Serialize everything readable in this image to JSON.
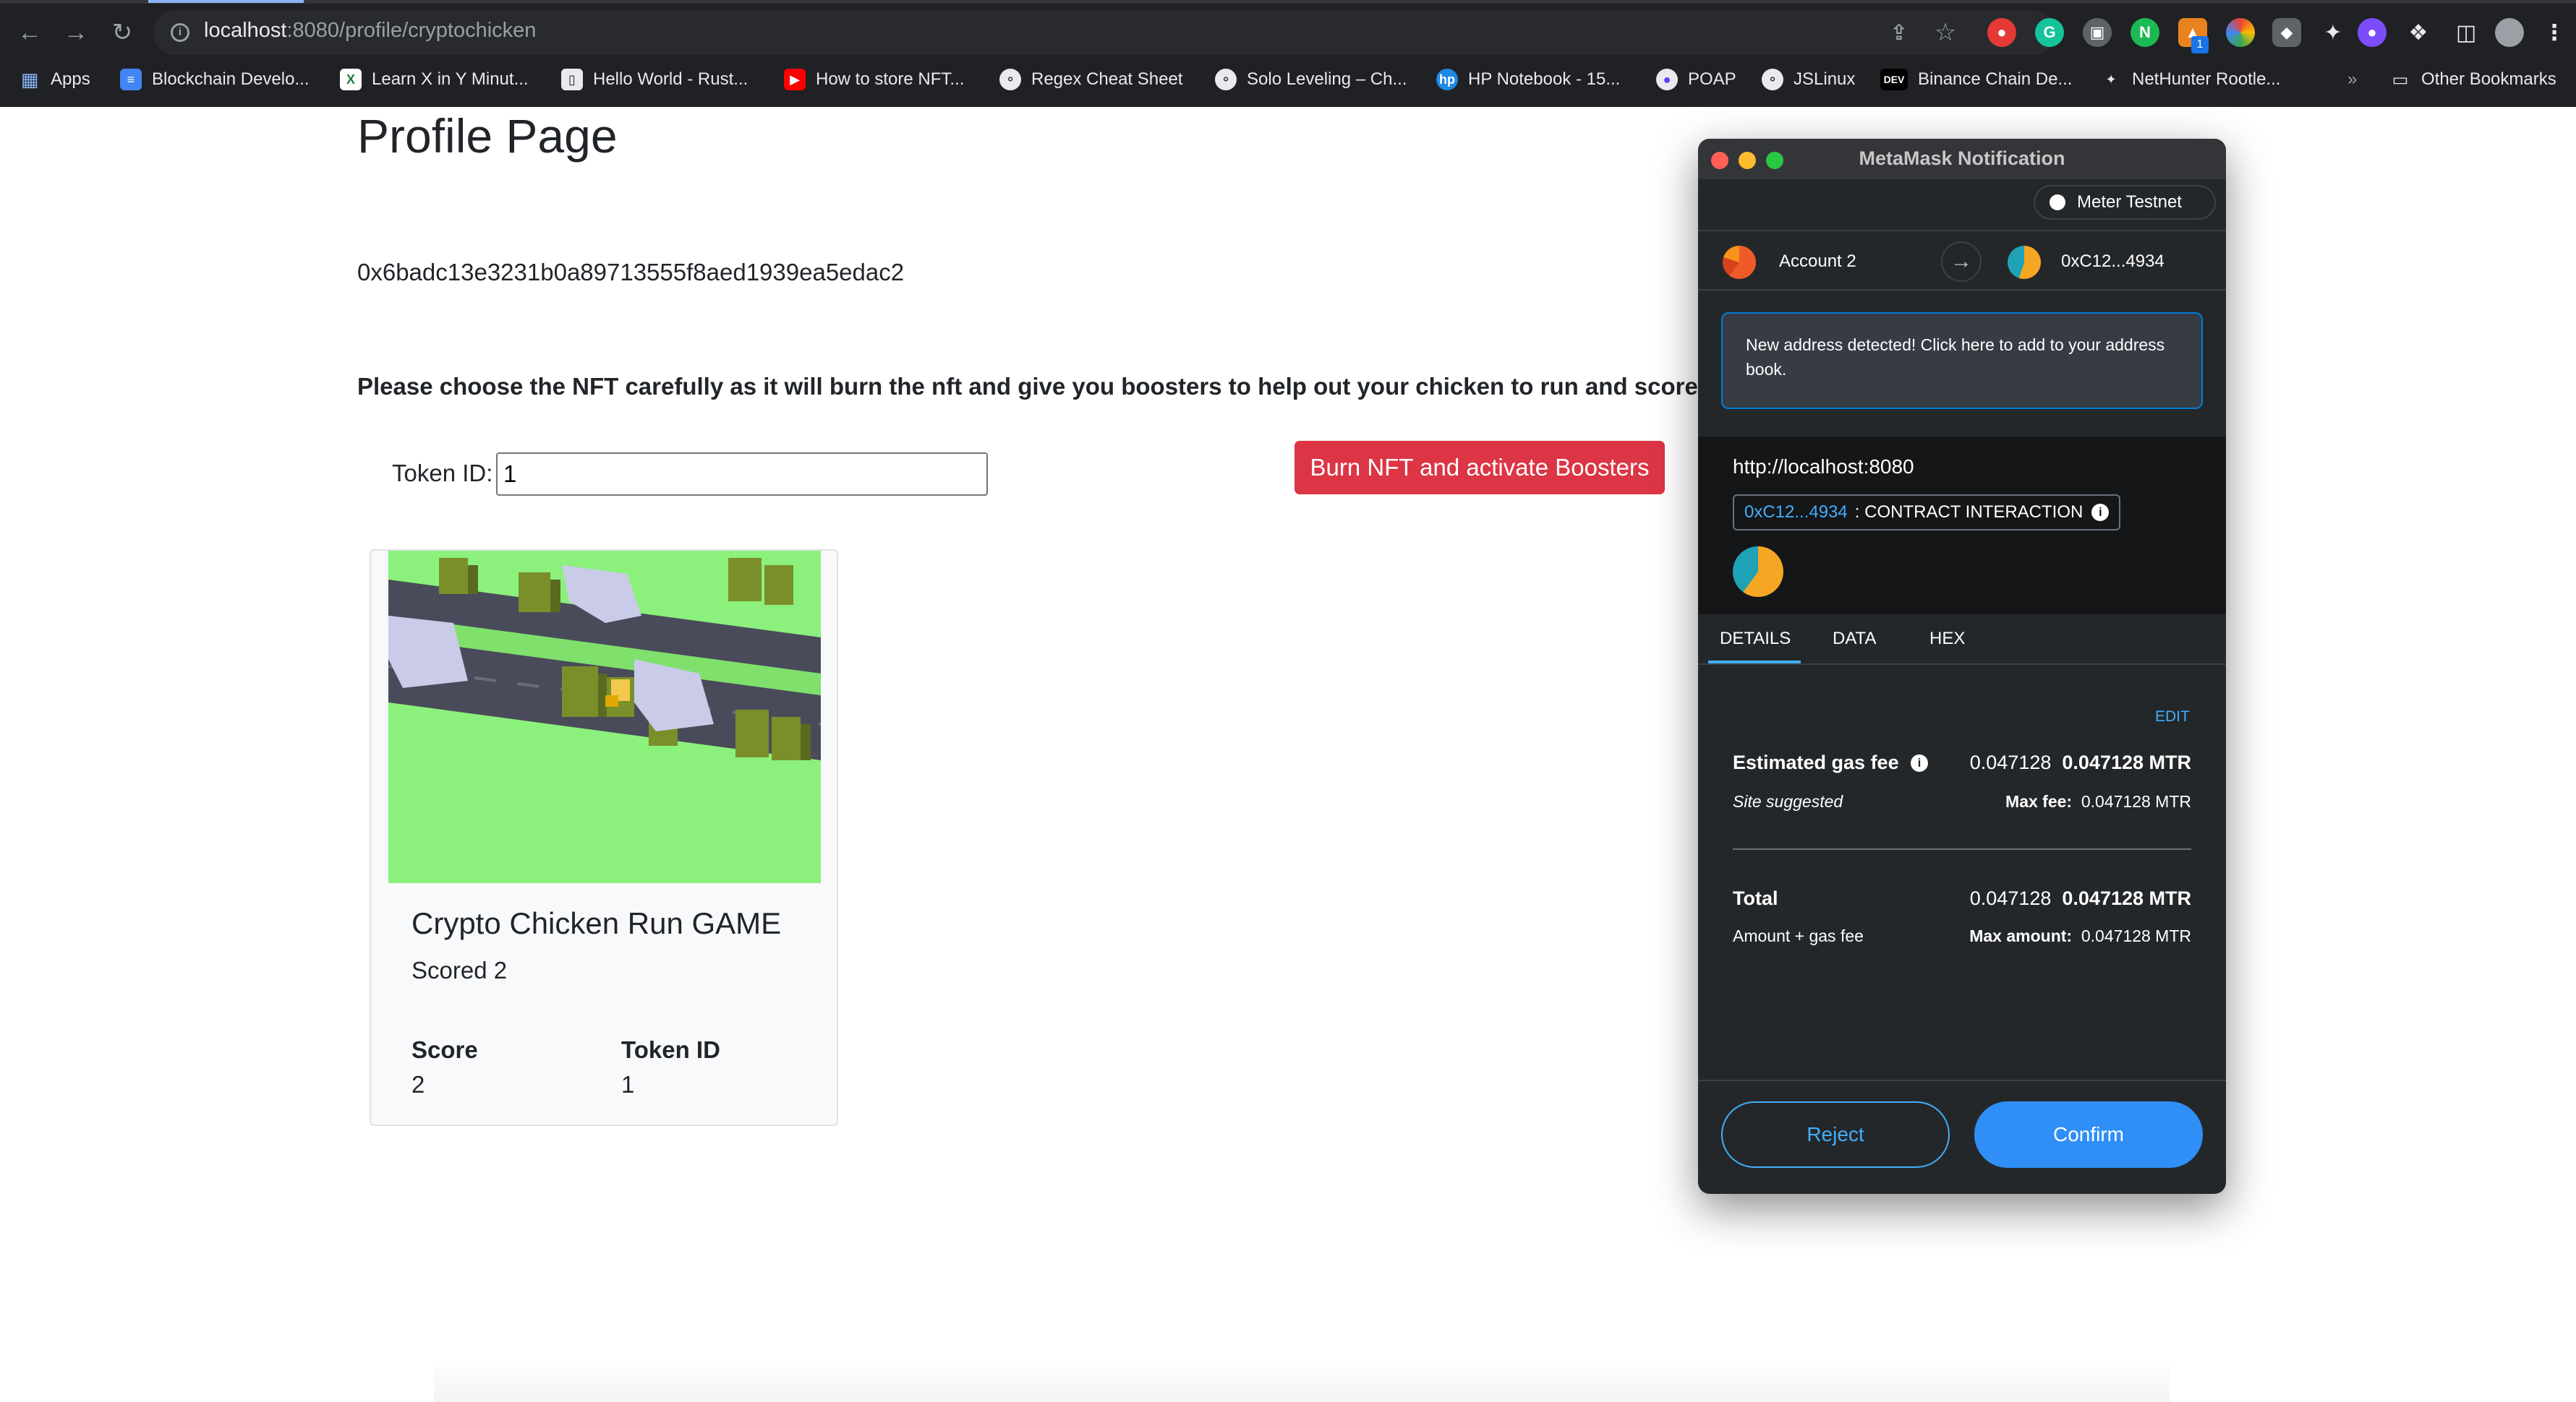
{
  "browser": {
    "url_host": "localhost",
    "url_path": ":8080/profile/cryptochicken",
    "bookmarks": [
      {
        "label": "Apps",
        "icon": "apps-grid-icon"
      },
      {
        "label": "Blockchain Develo...",
        "icon": "docs-icon"
      },
      {
        "label": "Learn X in Y Minut...",
        "icon": "x-logo-icon"
      },
      {
        "label": "Hello World - Rust...",
        "icon": "book-icon"
      },
      {
        "label": "How to store NFT...",
        "icon": "youtube-icon"
      },
      {
        "label": "Regex Cheat Sheet",
        "icon": "globe-icon"
      },
      {
        "label": "Solo Leveling – Ch...",
        "icon": "globe-icon"
      },
      {
        "label": "HP Notebook - 15...",
        "icon": "hp-logo-icon"
      },
      {
        "label": "POAP",
        "icon": "poap-icon"
      },
      {
        "label": "JSLinux",
        "icon": "globe-icon"
      },
      {
        "label": "Binance Chain De...",
        "icon": "dev-icon"
      },
      {
        "label": "NetHunter Rootle...",
        "icon": "nethunter-icon"
      }
    ],
    "overflow_label": "»",
    "other_bookmarks": "Other Bookmarks",
    "extension_badge": "1"
  },
  "page": {
    "title": "Profile Page",
    "wallet_address": "0x6badc13e3231b0a89713555f8aed1939ea5edac2",
    "warning": "Please choose the NFT carefully as it will burn the nft and give you boosters to help out your chicken to run and score mo",
    "token_label": "Token ID:",
    "token_value": "1",
    "burn_button": "Burn NFT and activate Boosters"
  },
  "card": {
    "title": "Crypto Chicken Run GAME",
    "subtitle": "Scored 2",
    "score_label": "Score",
    "score_value": "2",
    "token_label": "Token ID",
    "token_value": "1"
  },
  "metamask": {
    "window_title": "MetaMask Notification",
    "network": "Meter Testnet",
    "from_account": "Account 2",
    "to_account": "0xC12...4934",
    "notice": "New address detected! Click here to add to your address book.",
    "origin": "http://localhost:8080",
    "contract_address": "0xC12...4934",
    "contract_label": ": CONTRACT INTERACTION",
    "tabs": [
      "DETAILS",
      "DATA",
      "HEX"
    ],
    "active_tab": "DETAILS",
    "edit": "EDIT",
    "gas_label": "Estimated gas fee",
    "gas_value": "0.047128",
    "gas_value_bold": "0.047128 MTR",
    "site_suggested": "Site suggested",
    "max_fee_label": "Max fee:",
    "max_fee_value": "0.047128 MTR",
    "total_label": "Total",
    "total_value": "0.047128",
    "total_value_bold": "0.047128 MTR",
    "amount_gas_label": "Amount + gas fee",
    "max_amount_label": "Max amount:",
    "max_amount_value": "0.047128 MTR",
    "reject": "Reject",
    "confirm": "Confirm"
  },
  "colors": {
    "danger": "#dc3545",
    "metamask_blue": "#43aefc",
    "confirm_blue": "#2f8ff7",
    "metamask_bg": "#24272a"
  }
}
